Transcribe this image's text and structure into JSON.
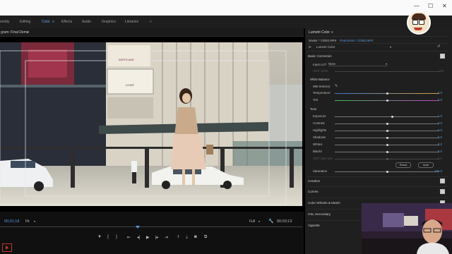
{
  "workspace_tabs": [
    {
      "label": "embly",
      "active": false
    },
    {
      "label": "Editing",
      "active": false
    },
    {
      "label": "Color",
      "active": true
    },
    {
      "label": "Effects",
      "active": false
    },
    {
      "label": "Audio",
      "active": false
    },
    {
      "label": "Graphics",
      "active": false
    },
    {
      "label": "Libraries",
      "active": false
    }
  ],
  "program": {
    "title": "gram: Final Demo",
    "menu": "≡"
  },
  "timecode": {
    "current": "00;01;18",
    "end": "00;03;13",
    "fit": "Fit",
    "quality": "Full"
  },
  "video": {
    "sign_top": "WESTLAKE",
    "sign_mid": "L3 507"
  },
  "lumetri": {
    "panel_title": "Lumetri Color",
    "source_master": "Master * C0062.MP4",
    "source_clip": "Final Demo * C0062.MP4",
    "fx_label": "fx",
    "effect_name": "Lumetri Color",
    "basic_correction": "Basic Correction",
    "input_lut_label": "Input LUT",
    "input_lut_value": "None",
    "hdr_white_label": "HDR White",
    "hdr_white_value": "100",
    "white_balance": "White Balance",
    "wb_selector": "WB Selector",
    "temperature": {
      "label": "Temperature",
      "value": "0.0",
      "level": 0.5
    },
    "tint": {
      "label": "Tint",
      "value": "0.0",
      "level": 0.5
    },
    "tone": "Tone",
    "tone_rows": [
      {
        "label": "Exposure",
        "value": "1.0",
        "level": 0.55
      },
      {
        "label": "Contrast",
        "value": "0.0",
        "level": 0.5
      },
      {
        "label": "Highlights",
        "value": "0.0",
        "level": 0.5
      },
      {
        "label": "Shadows",
        "value": "0.0",
        "level": 0.5
      },
      {
        "label": "Whites",
        "value": "0.0",
        "level": 0.5
      },
      {
        "label": "Blacks",
        "value": "0.0",
        "level": 0.5
      },
      {
        "label": "HDR Specular",
        "value": "0.0",
        "level": 0.5
      }
    ],
    "reset": "Reset",
    "auto": "Auto",
    "saturation": {
      "label": "Saturation",
      "value": "100.0",
      "level": 0.5
    },
    "creative": "Creative",
    "curves": "Curves",
    "color_wheels": "Color Wheels & Match",
    "hsl": "HSL Secondary",
    "vignette": "Vignette"
  },
  "colors": {
    "accent": "#5a9ae0",
    "panel_bg": "#1f1f1f",
    "topbar": "#fafafa"
  }
}
